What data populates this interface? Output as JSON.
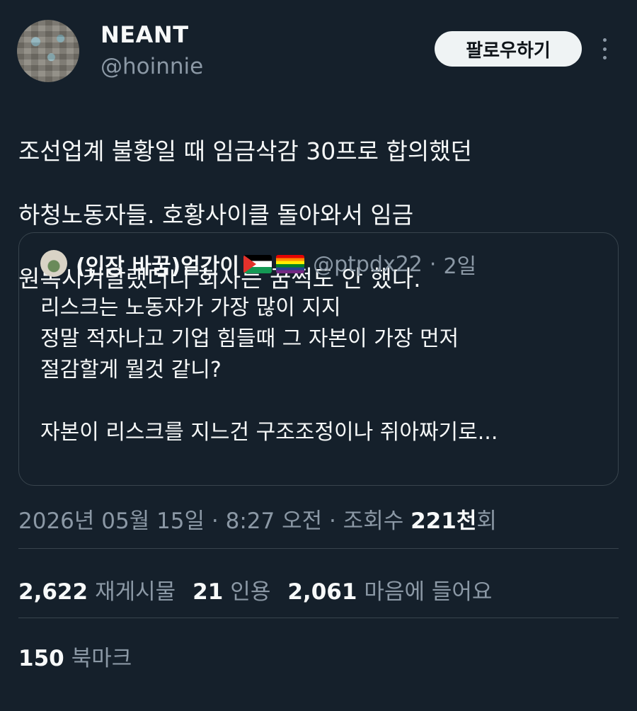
{
  "author": {
    "name": "NEANT",
    "handle": "@hoinnie",
    "follow_label": "팔로우하기"
  },
  "tweet": {
    "lines": [
      "조선업계 불황일 때 임금삭감 30프로 합의했던",
      "하청노동자들. 호황사이클 돌아와서 임금",
      "원복시켜달랬더니 회사는 꿈쩍도 안 했다."
    ]
  },
  "quote": {
    "name": "(인장 바꿈)얼간이",
    "flags": [
      "palestine-flag",
      "rainbow-flag"
    ],
    "handle": "@ptpdx22",
    "separator": "·",
    "time": "2일",
    "lines": [
      "리스크는 노동자가 가장 많이 지지",
      "정말 적자나고 기업 힘들때 그 자본이 가장 먼저",
      "절감할게 뭘것 같니?",
      "",
      "자본이 리스크를 지느건 구조조정이나 쥐아짜기로..."
    ]
  },
  "meta": {
    "timestamp": "2026년 05월 15일 · 8:27 오전 · 조회수 ",
    "views_value": "221천",
    "views_suffix": "회"
  },
  "stats": {
    "retweets_value": "2,622",
    "retweets_label": "재게시물",
    "quotes_value": "21",
    "quotes_label": "인용",
    "likes_value": "2,061",
    "likes_label": "마음에 들어요",
    "bookmarks_value": "150",
    "bookmarks_label": "북마크"
  },
  "colors": {
    "background": "#15202b",
    "text": "#f7f9f9",
    "secondary_text": "#8b98a5",
    "border": "#38444d",
    "button_bg": "#eff3f4"
  }
}
